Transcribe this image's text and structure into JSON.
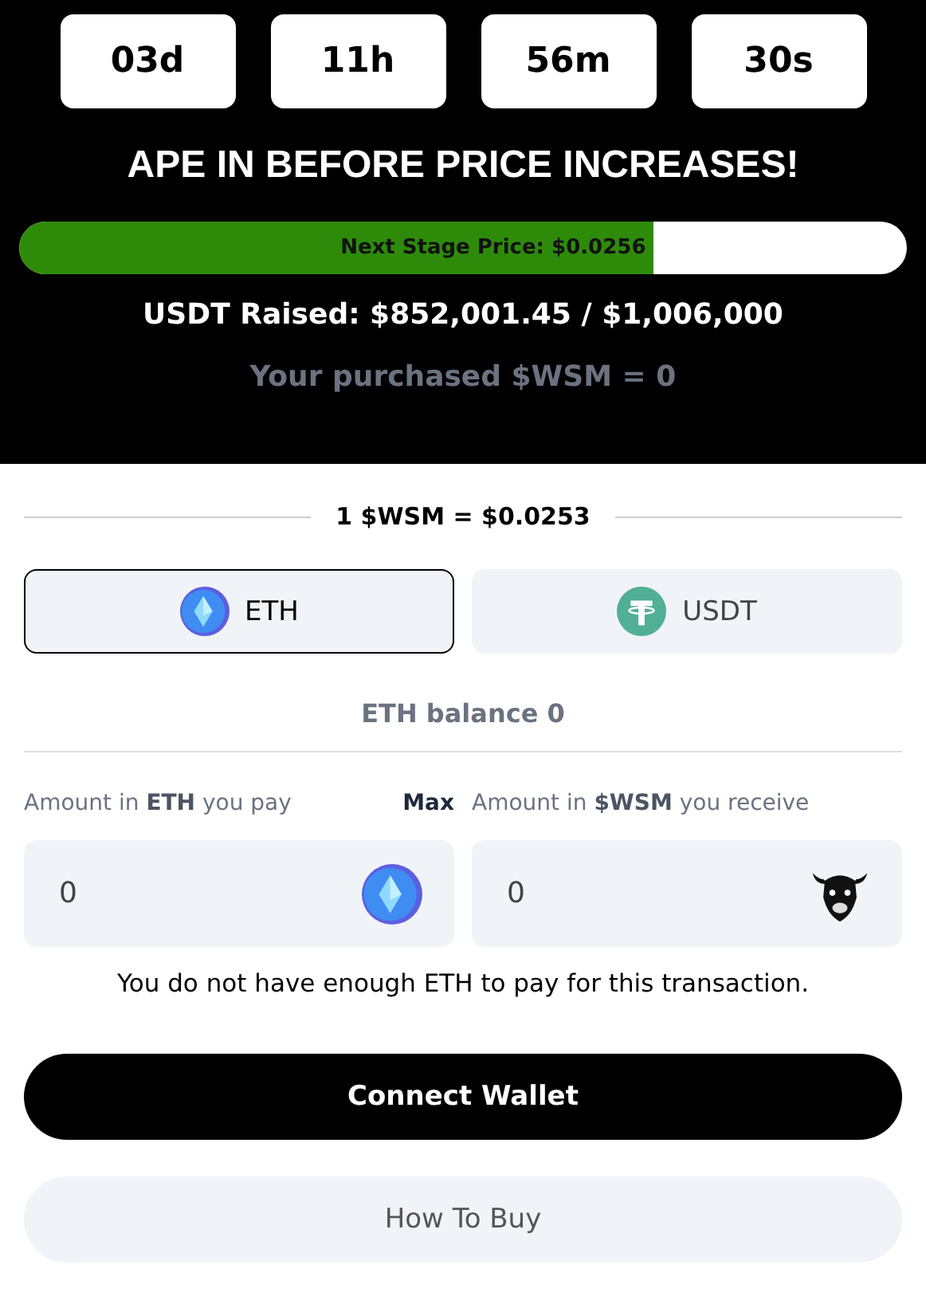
{
  "countdown": [
    {
      "value": "03d"
    },
    {
      "value": "11h"
    },
    {
      "value": "56m"
    },
    {
      "value": "30s"
    }
  ],
  "headline": "APE IN BEFORE PRICE INCREASES!",
  "progress": {
    "label": "Next Stage Price: $0.0256",
    "level": 0.715
  },
  "raised": "USDT Raised: $852,001.45 / $1,006,000",
  "purchased": "Your purchased $WSM = 0",
  "rate": "1 $WSM = $0.0253",
  "tokens": [
    {
      "kind": "eth",
      "label": "ETH",
      "selected": true
    },
    {
      "kind": "usdt",
      "label": "USDT",
      "selected": false
    }
  ],
  "balance": "ETH balance 0",
  "pay": {
    "label": "Amount in **ETH** you pay",
    "max": "Max",
    "value": "0"
  },
  "receive": {
    "label": "Amount in **$WSM** you receive",
    "value": "0"
  },
  "warning": "You do not have enough ETH to pay for this transaction.",
  "buttons": [
    {
      "kind": "primary",
      "label": "Connect Wallet"
    },
    {
      "kind": "secondary",
      "label": "How To Buy"
    }
  ]
}
